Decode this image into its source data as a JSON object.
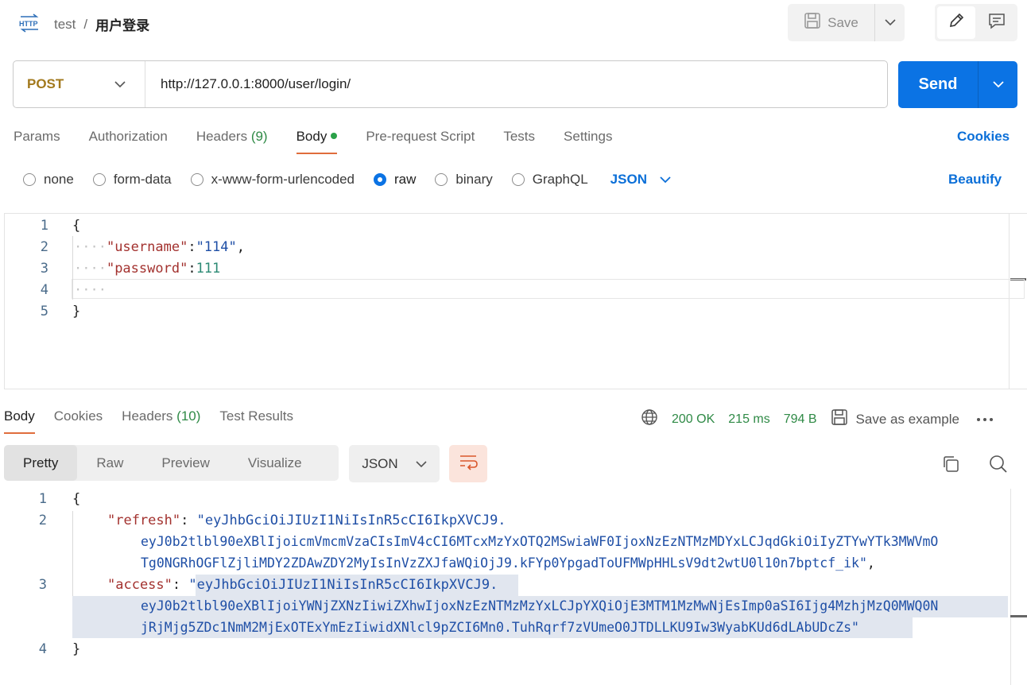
{
  "header": {
    "protocol_icon": "HTTP",
    "collection": "test",
    "separator": "/",
    "request_name": "用户登录",
    "save_label": "Save"
  },
  "request": {
    "method": "POST",
    "url": "http://127.0.0.1:8000/user/login/",
    "send_label": "Send"
  },
  "tabs": {
    "params": "Params",
    "authorization": "Authorization",
    "headers": "Headers",
    "headers_count": "(9)",
    "body": "Body",
    "prerequest": "Pre-request Script",
    "tests": "Tests",
    "settings": "Settings",
    "cookies": "Cookies"
  },
  "body_types": {
    "none": "none",
    "form_data": "form-data",
    "urlencoded": "x-www-form-urlencoded",
    "raw": "raw",
    "binary": "binary",
    "graphql": "GraphQL",
    "format": "JSON",
    "beautify": "Beautify",
    "selected": "raw"
  },
  "request_body": {
    "line_numbers": [
      "1",
      "2",
      "3",
      "4",
      "5"
    ],
    "open_brace": "{",
    "close_brace": "}",
    "username_key": "\"username\"",
    "username_value": "\"114\"",
    "password_key": "\"password\"",
    "password_value": "111",
    "colon": ":",
    "comma": ","
  },
  "response": {
    "tabs": {
      "body": "Body",
      "cookies": "Cookies",
      "headers": "Headers",
      "headers_count": "(10)",
      "test_results": "Test Results"
    },
    "status": "200 OK",
    "time": "215 ms",
    "size": "794 B",
    "save_example": "Save as example",
    "view_modes": {
      "pretty": "Pretty",
      "raw": "Raw",
      "preview": "Preview",
      "visualize": "Visualize"
    },
    "format": "JSON",
    "line_numbers": [
      "1",
      "2",
      "3",
      "4"
    ],
    "open_brace": "{",
    "close_brace": "}",
    "refresh_key": "\"refresh\"",
    "refresh_value_1": "\"eyJhbGciOiJIUzI1NiIsInR5cCI6IkpXVCJ9.",
    "refresh_value_2": "eyJ0b2tlbl90eXBlIjoicmVmcmVzaCIsImV4cCI6MTcxMzYxOTQ2MSwiaWF0IjoxNzEzNTMzMDYxLCJqdGkiOiIyZTYwYTk3MWVmO",
    "refresh_value_3": "Tg0NGRhOGFlZjliMDY2ZDAwZDY2MyIsInVzZXJfaWQiOjJ9.kFYp0YpgadToUFMWpHHLsV9dt2wtU0l10n7bptcf_ik\"",
    "access_key": "\"access\"",
    "access_value_1": "\"eyJhbGciOiJIUzI1NiIsInR5cCI6IkpXVCJ9.",
    "access_value_2": "eyJ0b2tlbl90eXBlIjoiYWNjZXNzIiwiZXhwIjoxNzEzNTMzMzYxLCJpYXQiOjE3MTM1MzMwNjEsImp0aSI6Ijg4MzhjMzQ0MWQ0N",
    "access_value_3": "jRjMjg5ZDc1NmM2MjExOTExYmEzIiwidXNlcl9pZCI6Mn0.TuhRqrf7zVUmeO0JTDLLKU9Iw3WyabKUd6dLAbUDcZs\""
  }
}
